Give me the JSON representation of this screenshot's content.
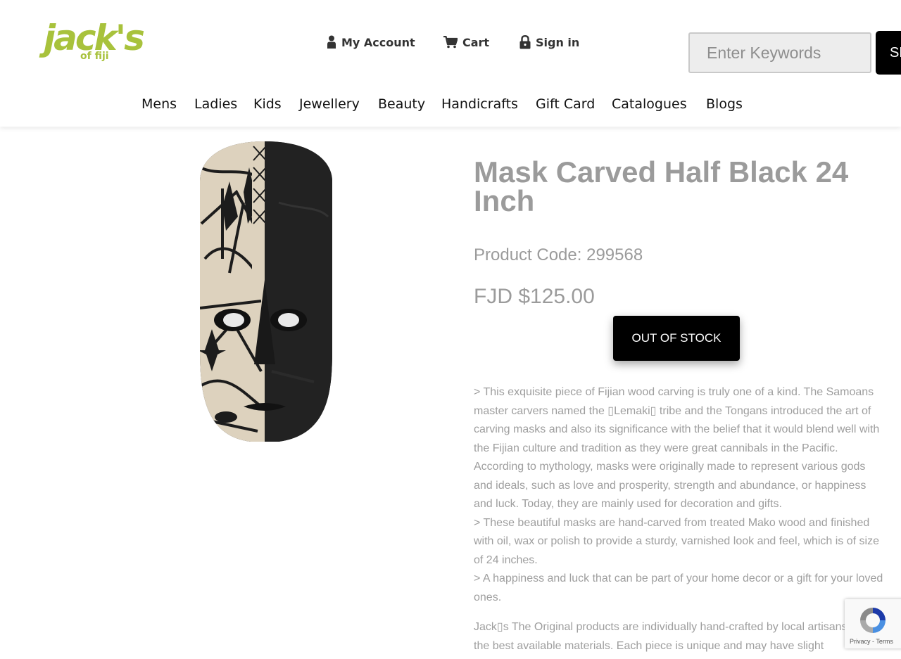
{
  "header": {
    "logo": {
      "word": "jack's",
      "sub": "of fiji"
    },
    "account_links": [
      {
        "label": "My Account",
        "icon": "user-icon"
      },
      {
        "label": "Cart",
        "icon": "cart-icon"
      },
      {
        "label": "Sign in",
        "icon": "lock-icon"
      }
    ],
    "search": {
      "placeholder": "Enter Keywords",
      "button_label": "SEARCH"
    }
  },
  "nav": {
    "items": [
      "Mens",
      "Ladies",
      "Kids",
      "Jewellery",
      "Beauty",
      "Handicrafts",
      "Gift Card",
      "Catalogues",
      "Blogs"
    ]
  },
  "product": {
    "title": "Mask Carved Half Black 24 Inch",
    "code": "Product Code: 299568",
    "price": "FJD $125.00",
    "stock_button": "OUT OF STOCK",
    "description": [
      "> This exquisite piece of Fijian wood carving is truly one of a kind. The Samoans master carvers named the ▯Lemaki▯ tribe and the Tongans introduced the art of carving masks and also its significance with the belief that it would blend well with the Fijian culture and tradition as they were great cannibals in the Pacific. According to mythology, masks were originally made to represent various gods and ideals, such as love and prosperity, strength and abundance, or happiness and luck. Today, they are mainly used for decoration and gifts.",
      "> These beautiful masks are hand-carved from treated Mako wood and finished with oil, wax or polish to provide a sturdy, varnished look and feel, which is of size of 24 inches.",
      "> A happiness and luck that can be part of your home decor or a gift for your loved ones.",
      "Jack▯s The Original products are individually hand-crafted by local artisans using the best available materials. Each piece is unique and may have slight"
    ]
  },
  "recaptcha": {
    "links": "Privacy - Terms"
  }
}
